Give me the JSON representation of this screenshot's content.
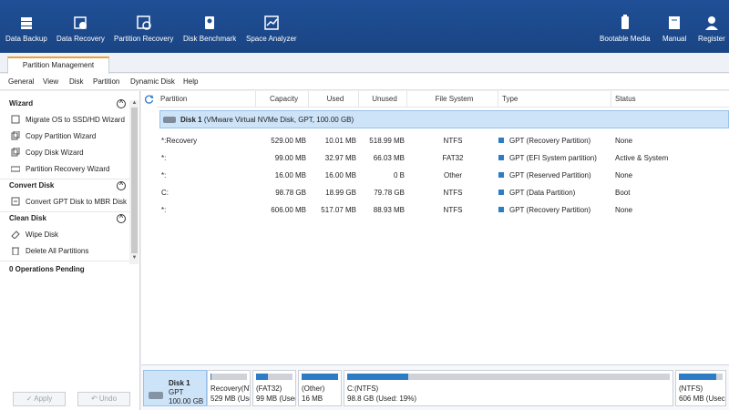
{
  "toolbar": {
    "left": [
      {
        "label": "Data Backup",
        "icon": "data-backup-icon"
      },
      {
        "label": "Data Recovery",
        "icon": "data-recovery-icon"
      },
      {
        "label": "Partition Recovery",
        "icon": "partition-recovery-icon"
      },
      {
        "label": "Disk Benchmark",
        "icon": "disk-benchmark-icon"
      },
      {
        "label": "Space Analyzer",
        "icon": "space-analyzer-icon"
      }
    ],
    "right": [
      {
        "label": "Bootable Media",
        "icon": "bootable-media-icon"
      },
      {
        "label": "Manual",
        "icon": "manual-icon"
      },
      {
        "label": "Register",
        "icon": "register-icon"
      }
    ]
  },
  "tab": {
    "label": "Partition Management"
  },
  "menu": [
    "General",
    "View",
    "Disk",
    "Partition",
    "Dynamic Disk",
    "Help"
  ],
  "sidebar": {
    "wizard": {
      "title": "Wizard",
      "items": [
        "Migrate OS to SSD/HD Wizard",
        "Copy Partition Wizard",
        "Copy Disk Wizard",
        "Partition Recovery Wizard"
      ]
    },
    "convert": {
      "title": "Convert Disk",
      "items": [
        "Convert GPT Disk to MBR Disk"
      ]
    },
    "clean": {
      "title": "Clean Disk",
      "items": [
        "Wipe Disk",
        "Delete All Partitions"
      ]
    },
    "pending": "0 Operations Pending",
    "apply_label": "✓ Apply",
    "undo_label": "↶ Undo"
  },
  "table": {
    "headers": [
      "Partition",
      "Capacity",
      "Used",
      "Unused",
      "File System",
      "Type",
      "Status"
    ],
    "disk_label": "Disk 1",
    "disk_desc": "(VMware Virtual NVMe Disk, GPT, 100.00 GB)",
    "rows": [
      {
        "partition": "*:Recovery",
        "capacity": "529.00 MB",
        "used": "10.01 MB",
        "unused": "518.99 MB",
        "fs": "NTFS",
        "type": "GPT (Recovery Partition)",
        "status": "None"
      },
      {
        "partition": "*:",
        "capacity": "99.00 MB",
        "used": "32.97 MB",
        "unused": "66.03 MB",
        "fs": "FAT32",
        "type": "GPT (EFI System partition)",
        "status": "Active & System"
      },
      {
        "partition": "*:",
        "capacity": "16.00 MB",
        "used": "16.00 MB",
        "unused": "0 B",
        "fs": "Other",
        "type": "GPT (Reserved Partition)",
        "status": "None"
      },
      {
        "partition": "C:",
        "capacity": "98.78 GB",
        "used": "18.99 GB",
        "unused": "79.78 GB",
        "fs": "NTFS",
        "type": "GPT (Data Partition)",
        "status": "Boot"
      },
      {
        "partition": "*:",
        "capacity": "606.00 MB",
        "used": "517.07 MB",
        "unused": "88.93 MB",
        "fs": "NTFS",
        "type": "GPT (Recovery Partition)",
        "status": "None"
      }
    ]
  },
  "diskmap": {
    "disk_name": "Disk 1",
    "disk_type": "GPT",
    "disk_size": "100.00 GB",
    "parts": [
      {
        "l1": "Recovery(NTI",
        "l2": "529 MB (Usec",
        "fill_pct": 2
      },
      {
        "l1": "(FAT32)",
        "l2": "99 MB (Used:",
        "fill_pct": 33
      },
      {
        "l1": "(Other)",
        "l2": "16 MB",
        "fill_pct": 100
      },
      {
        "l1": "C:(NTFS)",
        "l2": "98.8 GB (Used: 19%)",
        "fill_pct": 19
      },
      {
        "l1": "(NTFS)",
        "l2": "606 MB (Usec",
        "fill_pct": 85
      }
    ]
  },
  "colors": {
    "toolbar_bg": "#1f4f96",
    "accent": "#2d7dc6",
    "selection": "#cde3f8",
    "tab_accent": "#e8a33a"
  }
}
